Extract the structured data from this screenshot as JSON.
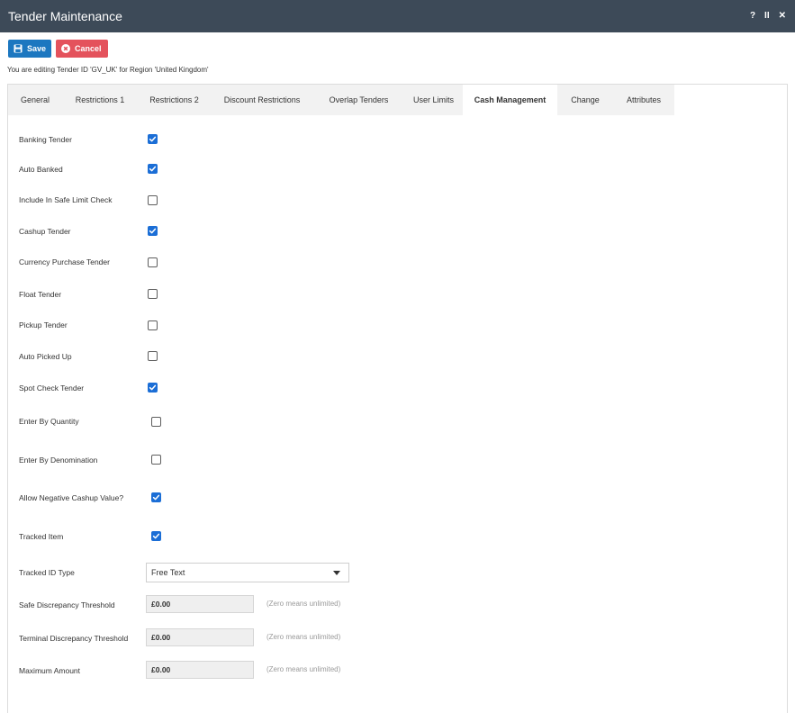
{
  "window": {
    "title": "Tender Maintenance",
    "controls": {
      "help": "?",
      "pause": "II",
      "close": "✕"
    }
  },
  "toolbar": {
    "save_label": "Save",
    "cancel_label": "Cancel"
  },
  "editing_text": "You are editing Tender ID 'GV_UK' for Region 'United Kingdom'",
  "tabs": [
    {
      "label": "General",
      "active": false
    },
    {
      "label": "Restrictions 1",
      "active": false
    },
    {
      "label": "Restrictions 2",
      "active": false
    },
    {
      "label": "Discount Restrictions",
      "active": false
    },
    {
      "label": "Overlap Tenders",
      "active": false
    },
    {
      "label": "User Limits",
      "active": false
    },
    {
      "label": "Cash Management",
      "active": true
    },
    {
      "label": "Change",
      "active": false
    },
    {
      "label": "Attributes",
      "active": false
    }
  ],
  "checkboxes": [
    {
      "label": "Banking Tender",
      "checked": true
    },
    {
      "label": "Auto Banked",
      "checked": true
    },
    {
      "label": "Include In Safe Limit Check",
      "checked": false
    },
    {
      "label": "Cashup Tender",
      "checked": true
    },
    {
      "label": "Currency Purchase Tender",
      "checked": false
    },
    {
      "label": "Float Tender",
      "checked": false
    },
    {
      "label": "Pickup Tender",
      "checked": false
    },
    {
      "label": "Auto Picked Up",
      "checked": false
    },
    {
      "label": "Spot Check Tender",
      "checked": true
    },
    {
      "label": "Enter By Quantity",
      "checked": false
    },
    {
      "label": "Enter By Denomination",
      "checked": false
    },
    {
      "label": "Allow Negative Cashup Value?",
      "checked": true
    },
    {
      "label": "Tracked Item",
      "checked": true
    }
  ],
  "tracked_id_type": {
    "label": "Tracked ID Type",
    "value": "Free Text"
  },
  "thresholds": [
    {
      "label": "Safe Discrepancy Threshold",
      "value": "£0.00",
      "hint": "(Zero means unlimited)"
    },
    {
      "label": "Terminal Discrepancy Threshold",
      "value": "£0.00",
      "hint": "(Zero means unlimited)"
    },
    {
      "label": "Maximum Amount",
      "value": "£0.00",
      "hint": "(Zero means unlimited)"
    }
  ],
  "colors": {
    "titlebar": "#3d4a58",
    "save": "#1c77c0",
    "cancel": "#e4525c",
    "checkbox_on": "#1b6ed6"
  }
}
